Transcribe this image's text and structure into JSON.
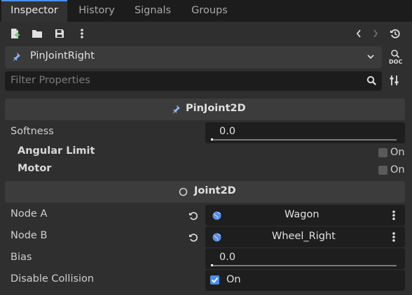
{
  "tabs": [
    {
      "label": "Inspector",
      "active": true
    },
    {
      "label": "History",
      "active": false
    },
    {
      "label": "Signals",
      "active": false
    },
    {
      "label": "Groups",
      "active": false
    }
  ],
  "toolbar": {
    "icons": [
      "new-resource-icon",
      "open-folder-icon",
      "save-icon",
      "more-vertical-icon",
      "history-back-icon",
      "history-forward-icon",
      "recent-history-icon"
    ]
  },
  "object": {
    "name": "PinJointRight",
    "icon": "pin-icon",
    "doc_label": "DOC"
  },
  "filter": {
    "placeholder": "Filter Properties"
  },
  "sections": {
    "pinjoint": {
      "title": "PinJoint2D"
    },
    "joint": {
      "title": "Joint2D"
    }
  },
  "properties": {
    "softness": {
      "label": "Softness",
      "value": "0.0",
      "fraction": 0
    },
    "angular_limit": {
      "label": "Angular Limit",
      "checked": false,
      "text": "On"
    },
    "motor": {
      "label": "Motor",
      "checked": false,
      "text": "On"
    },
    "node_a": {
      "label": "Node A",
      "value": "Wagon"
    },
    "node_b": {
      "label": "Node B",
      "value": "Wheel_Right"
    },
    "bias": {
      "label": "Bias",
      "value": "0.0",
      "fraction": 0
    },
    "disable_collision": {
      "label": "Disable Collision",
      "checked": true,
      "text": "On"
    }
  },
  "colors": {
    "accent": "#4a8ff0",
    "background": "#2f2f2f",
    "field": "#1e1e1e"
  }
}
